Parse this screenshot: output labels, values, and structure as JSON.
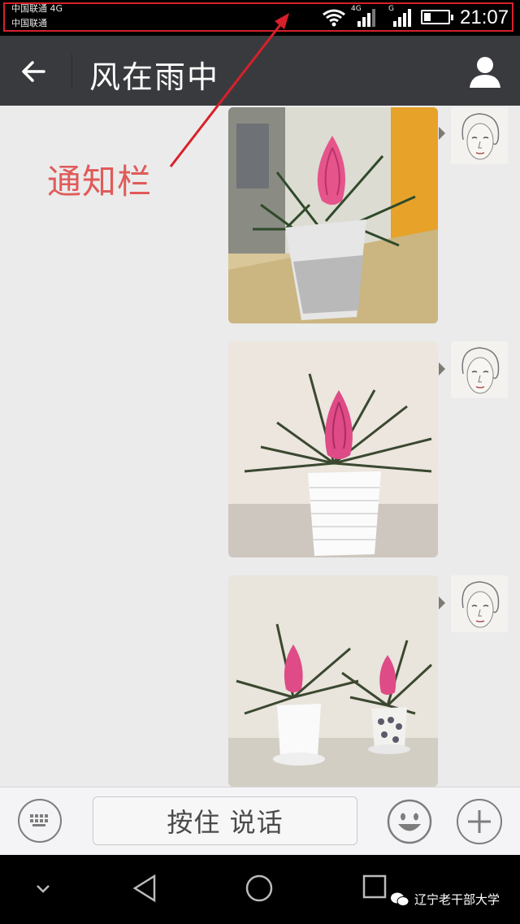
{
  "status_bar": {
    "carrier_line_1": "中国联通 4G",
    "carrier_line_2": "中国联通",
    "network_tag_1": "4G",
    "network_tag_2": "G",
    "battery_level": 0.3,
    "time": "21:07",
    "icons": [
      "wifi-icon",
      "signal-icon",
      "signal-icon",
      "battery-icon"
    ]
  },
  "header": {
    "title": "风在雨中",
    "back_icon": "arrow-left-icon",
    "profile_icon": "person-icon",
    "background": "#393a3e"
  },
  "annotation": {
    "label": "通知栏",
    "color": "#d8202a"
  },
  "messages": [
    {
      "type": "image",
      "content": "pink-flower-pot-window",
      "sender": "me"
    },
    {
      "type": "image",
      "content": "pink-flower-white-pot",
      "sender": "me"
    },
    {
      "type": "image",
      "content": "two-pink-flower-pots",
      "sender": "me"
    }
  ],
  "input_bar": {
    "voice_label": "按住 说话",
    "keyboard_icon": "keyboard-icon",
    "emoji_icon": "smiley-icon",
    "more_icon": "plus-icon"
  },
  "nav_bar": {
    "icons": [
      "chevron-down-icon",
      "back-triangle-icon",
      "home-circle-icon",
      "recents-square-icon"
    ]
  },
  "watermark": {
    "text": "辽宁老干部大学"
  }
}
